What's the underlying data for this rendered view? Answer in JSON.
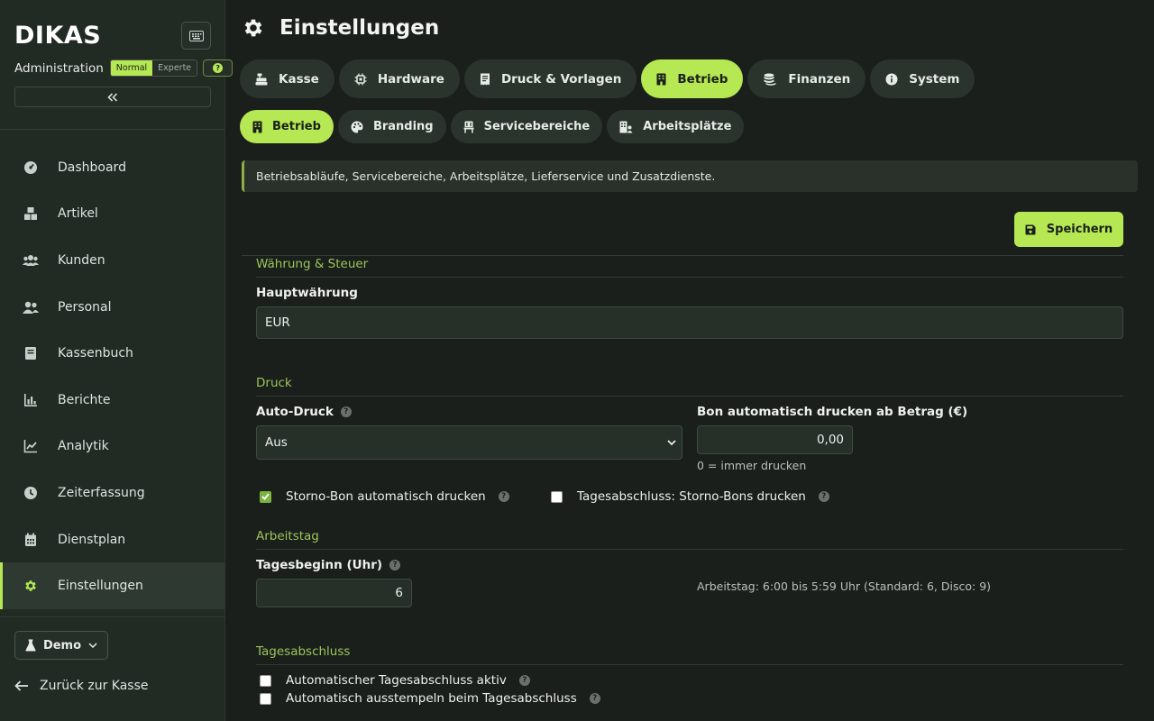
{
  "sidebar": {
    "logo": "DIKAS",
    "admin_label": "Administration",
    "modes": [
      "Normal",
      "Experte"
    ],
    "active_mode": "Normal",
    "help_icon": "question-icon",
    "collapse_icon": "double-chevron-left-icon",
    "items": [
      {
        "label": "Dashboard",
        "icon": "gauge-icon"
      },
      {
        "label": "Artikel",
        "icon": "boxes-icon"
      },
      {
        "label": "Kunden",
        "icon": "users-icon"
      },
      {
        "label": "Personal",
        "icon": "user-group-icon"
      },
      {
        "label": "Kassenbuch",
        "icon": "book-icon"
      },
      {
        "label": "Berichte",
        "icon": "bar-chart-icon"
      },
      {
        "label": "Analytik",
        "icon": "line-chart-icon"
      },
      {
        "label": "Zeiterfassung",
        "icon": "clock-icon"
      },
      {
        "label": "Dienstplan",
        "icon": "calendar-icon"
      },
      {
        "label": "Einstellungen",
        "icon": "gear-icon"
      }
    ],
    "active_item": "Einstellungen",
    "demo_label": "Demo",
    "back_label": "Zurück zur Kasse"
  },
  "header": {
    "title": "Einstellungen"
  },
  "tabs": [
    {
      "label": "Kasse",
      "icon": "cash-register-icon"
    },
    {
      "label": "Hardware",
      "icon": "chip-icon"
    },
    {
      "label": "Druck & Vorlagen",
      "icon": "receipt-icon"
    },
    {
      "label": "Betrieb",
      "icon": "building-icon"
    },
    {
      "label": "Finanzen",
      "icon": "coins-icon"
    },
    {
      "label": "System",
      "icon": "info-icon"
    }
  ],
  "active_tab": "Betrieb",
  "subtabs": [
    {
      "label": "Betrieb",
      "icon": "building-icon"
    },
    {
      "label": "Branding",
      "icon": "palette-icon"
    },
    {
      "label": "Servicebereiche",
      "icon": "chair-icon"
    },
    {
      "label": "Arbeitsplätze",
      "icon": "workplace-icon"
    }
  ],
  "active_subtab": "Betrieb",
  "info_text": "Betriebsabläufe, Servicebereiche, Arbeitsplätze, Lieferservice und Zusatzdienste.",
  "save_label": "Speichern",
  "sections": {
    "currency": {
      "title": "Währung & Steuer",
      "main_currency_label": "Hauptwährung",
      "main_currency_value": "EUR"
    },
    "print": {
      "title": "Druck",
      "auto_print_label": "Auto-Druck",
      "auto_print_value": "Aus",
      "threshold_label": "Bon automatisch drucken ab Betrag (€)",
      "threshold_value": "0,00",
      "threshold_hint": "0 = immer drucken",
      "storno_label": "Storno-Bon automatisch drucken",
      "storno_checked": true,
      "daily_storno_label": "Tagesabschluss: Storno-Bons drucken",
      "daily_storno_checked": false
    },
    "workday": {
      "title": "Arbeitstag",
      "start_label": "Tagesbeginn (Uhr)",
      "start_value": "6",
      "hint": "Arbeitstag: 6:00 bis 5:59 Uhr (Standard: 6, Disco: 9)"
    },
    "closing": {
      "title": "Tagesabschluss",
      "auto_close_label": "Automatischer Tagesabschluss aktiv",
      "auto_close_checked": false,
      "auto_clockout_label": "Automatisch ausstempeln beim Tagesabschluss",
      "auto_clockout_checked": false
    }
  },
  "colors": {
    "accent": "#b5e853",
    "background": "#1a1f1b",
    "sidebar": "#222a24",
    "section_title": "#9cc55a"
  }
}
